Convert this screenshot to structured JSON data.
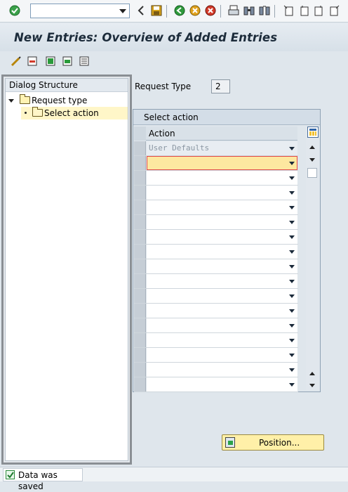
{
  "toolbar": {
    "command_field": "",
    "icons": [
      "enter-icon",
      "back-icon",
      "save-icon",
      "back-green-icon",
      "exit-icon",
      "cancel-icon",
      "print-icon",
      "find-icon",
      "find-next-icon",
      "first-page-icon",
      "prev-page-icon",
      "next-page-icon",
      "last-page-icon"
    ]
  },
  "title": "New Entries: Overview of Added Entries",
  "app_toolbar": {
    "icons": [
      "change-display-icon",
      "delete-icon",
      "select-all-icon",
      "select-block-icon",
      "deselect-all-icon"
    ]
  },
  "dialog": {
    "header": "Dialog Structure",
    "items": [
      {
        "label": "Request type"
      },
      {
        "label": "Select action"
      }
    ]
  },
  "request": {
    "label": "Request Type",
    "value": "2"
  },
  "table": {
    "title": "Select action",
    "column": "Action",
    "rows": [
      "User Defaults",
      "",
      "",
      "",
      "",
      "",
      "",
      "",
      "",
      "",
      "",
      "",
      "",
      "",
      "",
      "",
      ""
    ]
  },
  "position_button": "Position...",
  "status": {
    "message": "Data was saved"
  },
  "colors": {
    "highlight": "#fde8a0",
    "selection": "#fff6c8",
    "button": "#fff0a8"
  }
}
